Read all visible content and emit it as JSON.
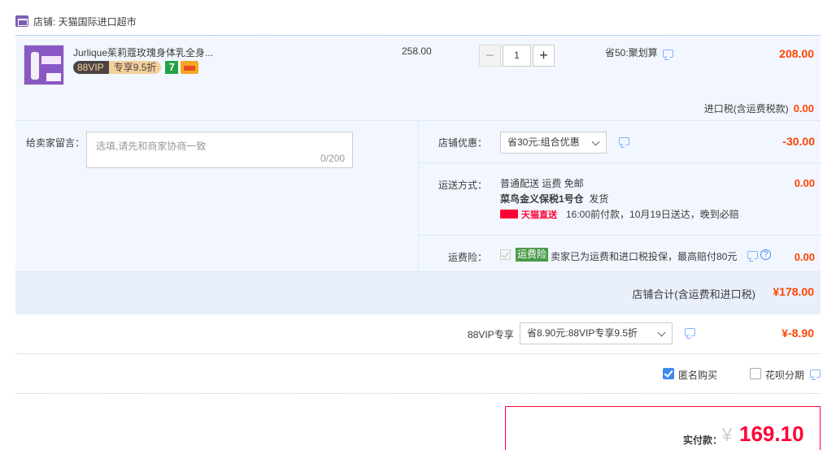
{
  "shop": {
    "label": "店铺: 天猫国际进口超市"
  },
  "item": {
    "title": "Jurlique茱莉蔻玫瑰身体乳全身...",
    "vip_badge_left": "88VIP",
    "vip_badge_right": "专享9.5折",
    "seven_badge": "7",
    "unit_price": "258.00",
    "quantity": "1",
    "promo": "省50:聚划算",
    "line_total": "208.00"
  },
  "tax": {
    "label": "进口税(含运费税款)",
    "value": "0.00"
  },
  "message": {
    "label": "给卖家留言：",
    "placeholder": "选填,请先和商家协商一致",
    "counter": "0/200"
  },
  "store_discount": {
    "label": "店铺优惠：",
    "selected": "省30元:组合优惠",
    "amount": "-30.00"
  },
  "shipping": {
    "label": "运送方式：",
    "line1": "普通配送 运费 免邮",
    "warehouse": "菜鸟金义保税1号仓",
    "dispatch": "发货",
    "tmall_direct": "天猫直送",
    "promise": "16:00前付款，10月19日送达，晚到必赔",
    "amount": "0.00"
  },
  "insurance": {
    "label": "运费险：",
    "tag": "运费险",
    "text": "卖家已为运费和进口税投保，最高赔付80元",
    "amount": "0.00"
  },
  "shop_total": {
    "label": "店铺合计(含运费和进口税)",
    "value": "¥178.00"
  },
  "vip": {
    "label": "88VIP专享",
    "selected": "省8.90元:88VIP专享9.5折",
    "amount": "¥-8.90"
  },
  "options": {
    "anonymous": "匿名购买",
    "anonymous_checked": true,
    "huabei": "花呗分期",
    "huabei_checked": false
  },
  "payment": {
    "label": "实付款：",
    "currency": "¥",
    "amount": "169.10"
  },
  "colors": {
    "price_red": "#ff4400",
    "pay_red": "#ff0036",
    "accent_blue": "#3d8bf2",
    "panel_bg": "#f2f7ff"
  },
  "icons": [
    "shop-icon",
    "chat-icon",
    "help-icon",
    "chevron-down-icon",
    "tmall-icon",
    "card-icon"
  ]
}
